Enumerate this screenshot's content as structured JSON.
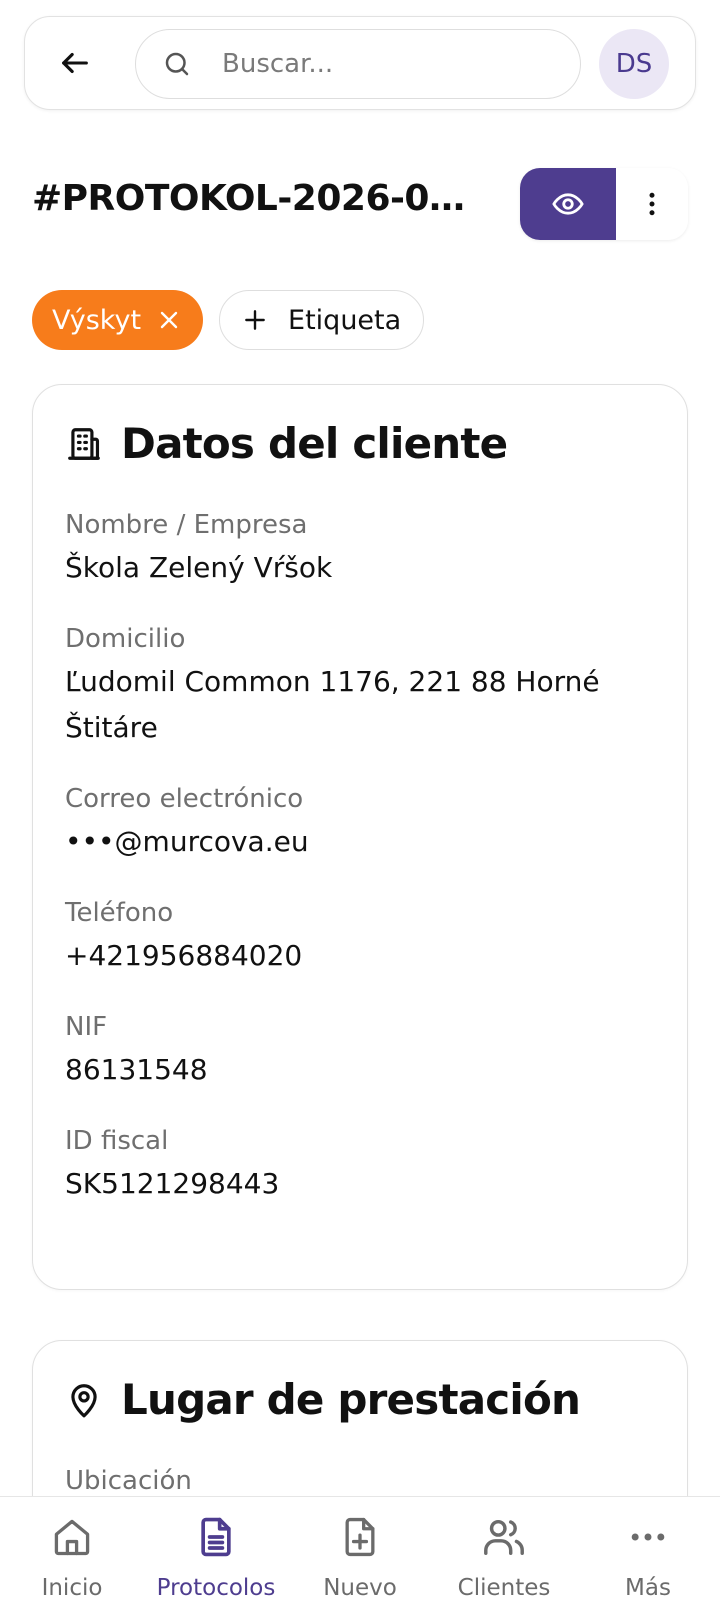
{
  "search": {
    "placeholder": "Buscar..."
  },
  "user": {
    "initials": "DS"
  },
  "page": {
    "title": "#PROTOKOL-2026-00..."
  },
  "tags": {
    "active_tag": "Výskyt",
    "add_label": "Etiqueta"
  },
  "client_card": {
    "title": "Datos del cliente",
    "fields": [
      {
        "label": "Nombre / Empresa",
        "value": "Škola Zelený Vŕšok"
      },
      {
        "label": "Domicilio",
        "value": "Ľudomil Common 1176, 221 88 Horné Štitáre"
      },
      {
        "label": "Correo electrónico",
        "value": "•••@murcova.eu"
      },
      {
        "label": "Teléfono",
        "value": "+421956884020"
      },
      {
        "label": "NIF",
        "value": "86131548"
      },
      {
        "label": "ID fiscal",
        "value": "SK5121298443"
      }
    ]
  },
  "place_card": {
    "title": "Lugar de prestación",
    "fields": [
      {
        "label": "Ubicación"
      }
    ]
  },
  "nav": {
    "items": [
      {
        "label": "Inicio",
        "icon": "home-icon"
      },
      {
        "label": "Protocolos",
        "icon": "document-icon",
        "active": true
      },
      {
        "label": "Nuevo",
        "icon": "new-document-icon"
      },
      {
        "label": "Clientes",
        "icon": "users-icon"
      },
      {
        "label": "Más",
        "icon": "more-horizontal-icon"
      }
    ]
  },
  "colors": {
    "accent": "#4e3d8f",
    "tag": "#f77c1b",
    "avatar_bg": "#ebe7f5"
  }
}
